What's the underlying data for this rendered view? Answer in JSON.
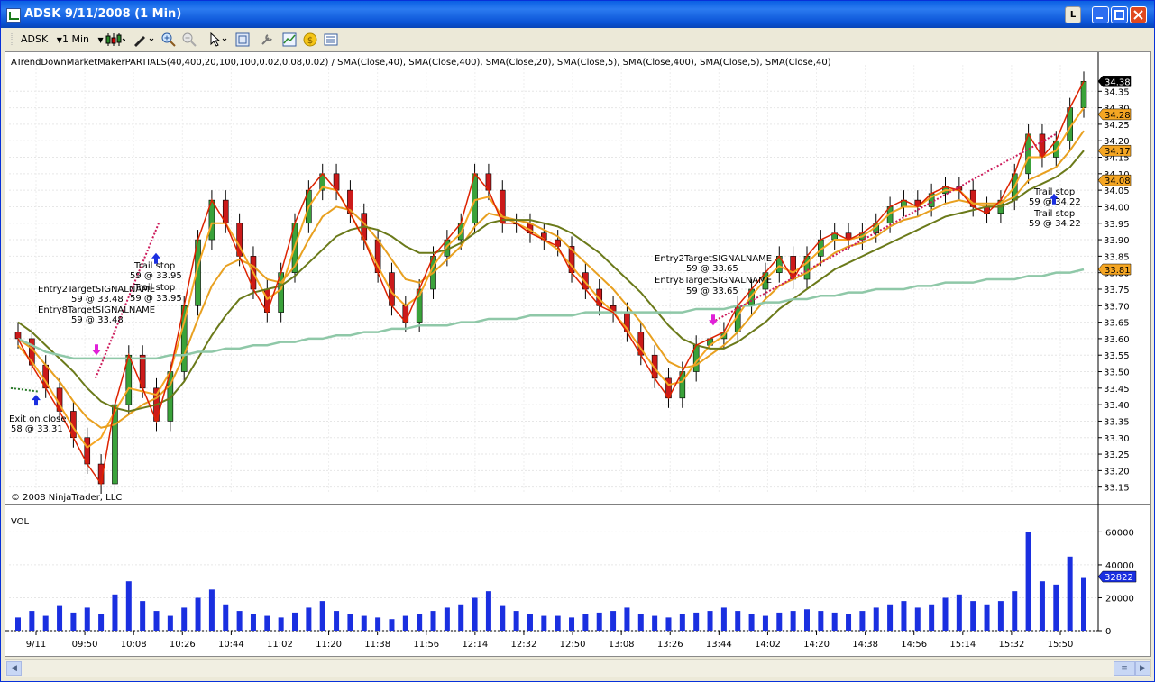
{
  "window": {
    "title": "ADSK  9/11/2008 (1 Min)",
    "l_button": "L"
  },
  "toolbar": {
    "instrument": "ADSK",
    "interval": "1 Min"
  },
  "chart": {
    "indicator_label": "ATrendDownMarketMakerPARTIALS(40,400,20,100,100,0.02,0.08,0.02) / SMA(Close,40), SMA(Close,400), SMA(Close,20), SMA(Close,5), SMA(Close,400), SMA(Close,5), SMA(Close,40)",
    "copyright": "© 2008 NinjaTrader, LLC",
    "volume_label": "VOL",
    "price_tags": [
      {
        "text": "34.38",
        "color": "#000000"
      },
      {
        "text": "34.28",
        "color": "#f5a623"
      },
      {
        "text": "34.17",
        "color": "#f5a623"
      },
      {
        "text": "34.08",
        "color": "#f5a623"
      },
      {
        "text": "33.81",
        "color": "#f5a623"
      }
    ],
    "volume_tag": "32822",
    "annotations": [
      {
        "text": "Exit on close"
      },
      {
        "text": "58 @ 33.31"
      },
      {
        "text": "Entry2TargetSIGNALNAME"
      },
      {
        "text": "59 @ 33.48"
      },
      {
        "text": "Entry8TargetSIGNALNAME"
      },
      {
        "text": "59 @ 33.48"
      },
      {
        "text": "Trail stop"
      },
      {
        "text": "59 @ 33.95"
      },
      {
        "text": "Trail stop"
      },
      {
        "text": "59 @ 33.95"
      },
      {
        "text": "Entry2TargetSIGNALNAME"
      },
      {
        "text": "59 @ 33.65"
      },
      {
        "text": "Entry8TargetSIGNALNAME"
      },
      {
        "text": "59 @ 33.65"
      },
      {
        "text": "Trail stop"
      },
      {
        "text": "59 @ 34.22"
      },
      {
        "text": "Trail stop"
      },
      {
        "text": "59 @ 34.22"
      }
    ]
  },
  "chart_data": {
    "type": "line",
    "title": "",
    "price_axis_ticks": [
      "34.35",
      "34.30",
      "34.25",
      "34.20",
      "34.15",
      "34.10",
      "34.05",
      "34.00",
      "33.95",
      "33.90",
      "33.85",
      "33.80",
      "33.75",
      "33.70",
      "33.65",
      "33.60",
      "33.55",
      "33.50",
      "33.45",
      "33.40",
      "33.35",
      "33.30",
      "33.25",
      "33.20",
      "33.15"
    ],
    "volume_axis_ticks": [
      "60000",
      "40000",
      "20000",
      "0"
    ],
    "time_axis_ticks": [
      "9/11",
      "09:50",
      "10:08",
      "10:26",
      "10:44",
      "11:02",
      "11:20",
      "11:38",
      "11:56",
      "12:14",
      "12:32",
      "12:50",
      "13:08",
      "13:26",
      "13:44",
      "14:02",
      "14:20",
      "14:38",
      "14:56",
      "15:14",
      "15:32",
      "15:50"
    ],
    "ylim": [
      33.13,
      34.43
    ],
    "grid": true,
    "series": [
      {
        "name": "Close",
        "color": "#cc0000",
        "values": [
          33.6,
          33.52,
          33.45,
          33.38,
          33.3,
          33.22,
          33.16,
          33.4,
          33.55,
          33.45,
          33.35,
          33.5,
          33.7,
          33.9,
          34.02,
          33.95,
          33.85,
          33.75,
          33.68,
          33.8,
          33.95,
          34.05,
          34.1,
          34.05,
          33.98,
          33.9,
          33.8,
          33.7,
          33.65,
          33.75,
          33.85,
          33.9,
          33.95,
          34.1,
          34.05,
          33.95,
          33.95,
          33.92,
          33.9,
          33.88,
          33.8,
          33.75,
          33.7,
          33.68,
          33.62,
          33.55,
          33.48,
          33.42,
          33.5,
          33.58,
          33.6,
          33.62,
          33.7,
          33.75,
          33.8,
          33.85,
          33.78,
          33.85,
          33.9,
          33.92,
          33.9,
          33.92,
          33.95,
          34.0,
          34.02,
          34.0,
          34.04,
          34.06,
          34.05,
          34.0,
          33.98,
          34.02,
          34.1,
          34.22,
          34.15,
          34.2,
          34.3,
          34.38
        ]
      },
      {
        "name": "SMA(Close,5)",
        "color": "#f5a623",
        "values": [
          33.58,
          33.53,
          33.47,
          33.4,
          33.33,
          33.27,
          33.3,
          33.38,
          33.45,
          33.44,
          33.43,
          33.5,
          33.65,
          33.82,
          33.95,
          33.95,
          33.88,
          33.8,
          33.72,
          33.75,
          33.88,
          34.0,
          34.06,
          34.05,
          33.98,
          33.9,
          33.82,
          33.74,
          33.7,
          33.73,
          33.82,
          33.88,
          33.92,
          34.02,
          34.03,
          33.97,
          33.95,
          33.93,
          33.9,
          33.87,
          33.82,
          33.77,
          33.72,
          33.68,
          33.63,
          33.57,
          33.51,
          33.46,
          33.47,
          33.53,
          33.58,
          33.61,
          33.67,
          33.73,
          33.78,
          33.82,
          33.8,
          33.83,
          33.87,
          33.9,
          33.9,
          33.91,
          33.94,
          33.98,
          34.0,
          34.0,
          34.03,
          34.05,
          34.05,
          34.01,
          34.0,
          34.01,
          34.06,
          34.15,
          34.15,
          34.17,
          34.24,
          34.3
        ]
      },
      {
        "name": "SMA(Close,20)",
        "color": "#e8a020",
        "values": [
          33.6,
          33.57,
          33.52,
          33.47,
          33.41,
          33.36,
          33.33,
          33.34,
          33.37,
          33.4,
          33.42,
          33.46,
          33.55,
          33.66,
          33.76,
          33.82,
          33.84,
          33.82,
          33.78,
          33.77,
          33.82,
          33.9,
          33.97,
          34.0,
          33.99,
          33.95,
          33.9,
          33.84,
          33.78,
          33.77,
          33.8,
          33.84,
          33.88,
          33.94,
          33.98,
          33.97,
          33.96,
          33.95,
          33.93,
          33.91,
          33.87,
          33.83,
          33.79,
          33.75,
          33.7,
          33.65,
          33.59,
          33.53,
          33.51,
          33.52,
          33.55,
          33.58,
          33.62,
          33.67,
          33.72,
          33.76,
          33.78,
          33.8,
          33.83,
          33.86,
          33.88,
          33.89,
          33.91,
          33.94,
          33.96,
          33.97,
          33.99,
          34.01,
          34.02,
          34.01,
          34.01,
          34.01,
          34.03,
          34.08,
          34.1,
          34.12,
          34.17,
          34.23
        ]
      },
      {
        "name": "SMA(Close,40)",
        "color": "#6b7a1a",
        "values": [
          33.65,
          33.62,
          33.58,
          33.54,
          33.5,
          33.45,
          33.41,
          33.39,
          33.38,
          33.39,
          33.4,
          33.42,
          33.47,
          33.54,
          33.61,
          33.67,
          33.72,
          33.74,
          33.75,
          33.76,
          33.79,
          33.83,
          33.87,
          33.91,
          33.93,
          33.94,
          33.93,
          33.91,
          33.88,
          33.86,
          33.86,
          33.87,
          33.89,
          33.92,
          33.95,
          33.96,
          33.96,
          33.96,
          33.95,
          33.94,
          33.92,
          33.89,
          33.86,
          33.82,
          33.78,
          33.74,
          33.69,
          33.64,
          33.6,
          33.58,
          33.57,
          33.57,
          33.59,
          33.62,
          33.65,
          33.69,
          33.72,
          33.75,
          33.78,
          33.81,
          33.83,
          33.85,
          33.87,
          33.89,
          33.91,
          33.93,
          33.95,
          33.97,
          33.98,
          33.99,
          34.0,
          34.0,
          34.02,
          34.05,
          34.07,
          34.09,
          34.12,
          34.17
        ]
      },
      {
        "name": "SMA(Close,400)",
        "color": "#8fc8a8",
        "values": [
          33.6,
          33.58,
          33.56,
          33.55,
          33.54,
          33.54,
          33.54,
          33.54,
          33.54,
          33.54,
          33.54,
          33.55,
          33.55,
          33.56,
          33.56,
          33.57,
          33.57,
          33.58,
          33.58,
          33.59,
          33.59,
          33.6,
          33.6,
          33.61,
          33.61,
          33.62,
          33.62,
          33.63,
          33.63,
          33.64,
          33.64,
          33.64,
          33.65,
          33.65,
          33.66,
          33.66,
          33.66,
          33.67,
          33.67,
          33.67,
          33.67,
          33.68,
          33.68,
          33.68,
          33.68,
          33.68,
          33.68,
          33.68,
          33.68,
          33.69,
          33.69,
          33.69,
          33.7,
          33.7,
          33.71,
          33.71,
          33.72,
          33.72,
          33.73,
          33.73,
          33.74,
          33.74,
          33.75,
          33.75,
          33.75,
          33.76,
          33.76,
          33.77,
          33.77,
          33.77,
          33.78,
          33.78,
          33.78,
          33.79,
          33.79,
          33.8,
          33.8,
          33.81
        ]
      }
    ],
    "volume": [
      8,
      12,
      9,
      15,
      11,
      14,
      10,
      22,
      30,
      18,
      12,
      9,
      14,
      20,
      25,
      16,
      12,
      10,
      9,
      8,
      11,
      14,
      18,
      12,
      10,
      9,
      8,
      7,
      9,
      10,
      12,
      14,
      16,
      20,
      24,
      15,
      12,
      10,
      9,
      9,
      8,
      10,
      11,
      12,
      14,
      10,
      9,
      8,
      10,
      11,
      12,
      14,
      12,
      10,
      9,
      11,
      12,
      13,
      12,
      11,
      10,
      12,
      14,
      16,
      18,
      14,
      16,
      20,
      22,
      18,
      16,
      18,
      24,
      60,
      30,
      28,
      45,
      32
    ]
  }
}
